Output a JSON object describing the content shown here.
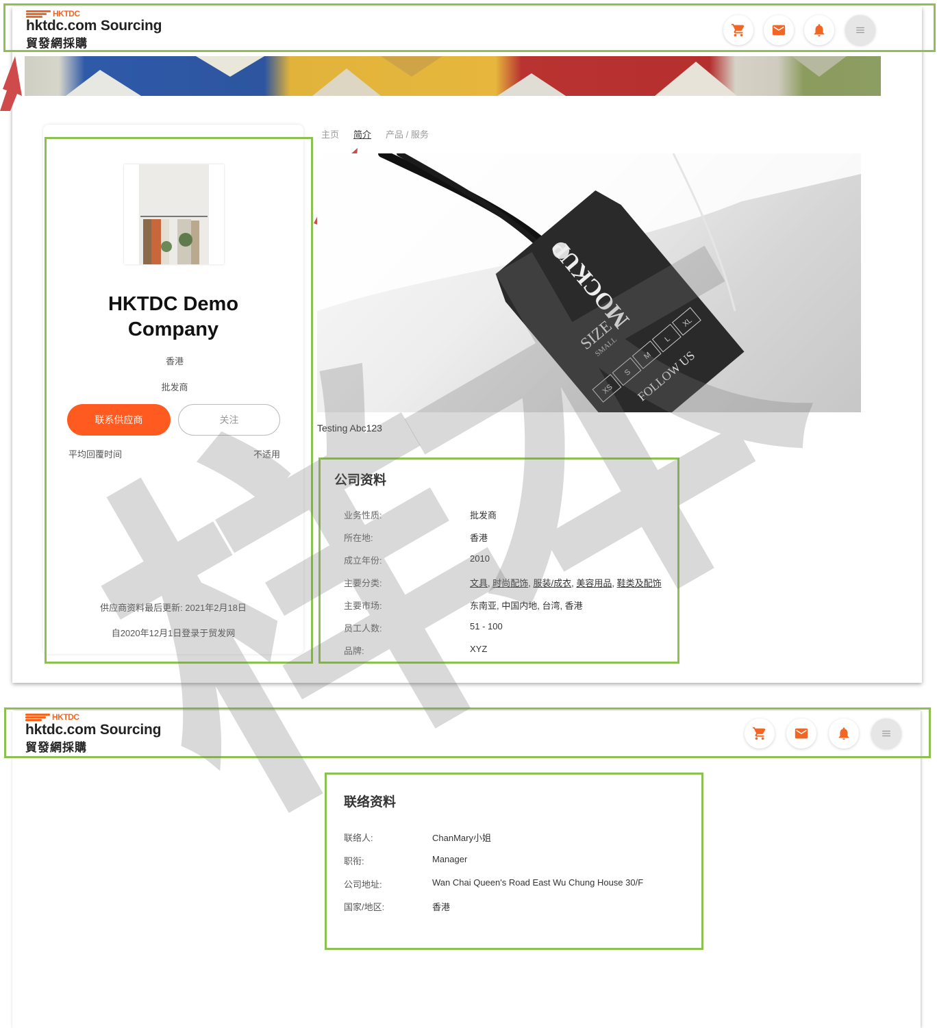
{
  "brand": {
    "logo_short": "HKTDC",
    "name_en": "hktdc.com Sourcing",
    "name_zh": "貿發網採購",
    "accent": "#f26522"
  },
  "header_icons": [
    "cart-icon",
    "mail-icon",
    "bell-icon",
    "menu-icon"
  ],
  "tabs": [
    {
      "label": "主页",
      "active": false
    },
    {
      "label": "简介",
      "active": true
    },
    {
      "label": "产品 / 服务",
      "active": false
    }
  ],
  "profile": {
    "company_name_line1": "HKTDC Demo",
    "company_name_line2": "Company",
    "location": "香港",
    "business_type": "批发商",
    "contact_button": "联系供应商",
    "follow_button": "关注",
    "response_time_label": "平均回覆时间",
    "response_time_value": "不适用",
    "last_updated": "供应商资料最后更新: 2021年2月18日",
    "joined": "自2020年12月1日登录于贸发网"
  },
  "hero": {
    "tag_text_1": "MOCKUP",
    "tag_text_2": "SIZE",
    "tag_text_3": "SMALL",
    "tag_text_4": "FOLLOW US",
    "sizes": [
      "XS",
      "S",
      "M",
      "L",
      "XL"
    ],
    "caption": "Testing Abc123"
  },
  "company_info": {
    "title": "公司资料",
    "rows": [
      {
        "label": "业务性质:",
        "value": "批发商"
      },
      {
        "label": "所在地:",
        "value": "香港"
      },
      {
        "label": "成立年份:",
        "value": "2010"
      },
      {
        "label": "主要分类:",
        "links": [
          "文具",
          "时尚配饰",
          "服装/成衣",
          "美容用品",
          "鞋类及配饰"
        ]
      },
      {
        "label": "主要市场:",
        "value": "东南亚, 中国内地, 台湾, 香港"
      },
      {
        "label": "员工人数:",
        "value": "51 - 100"
      },
      {
        "label": "品牌:",
        "value": "XYZ"
      }
    ]
  },
  "contact_info": {
    "title": "联络资料",
    "rows": [
      {
        "label": "联络人:",
        "value": "ChanMary小姐"
      },
      {
        "label": "职衔:",
        "value": "Manager"
      },
      {
        "label": "公司地址:",
        "value": "Wan Chai Queen's Road East Wu Chung House 30/F"
      },
      {
        "label": "国家/地区:",
        "value": "香港"
      }
    ]
  },
  "watermark": "样本",
  "colors": {
    "annotation_green": "#8cc152",
    "annotation_arrow": "#cf4a4a",
    "primary_button": "#ff5a1f"
  }
}
